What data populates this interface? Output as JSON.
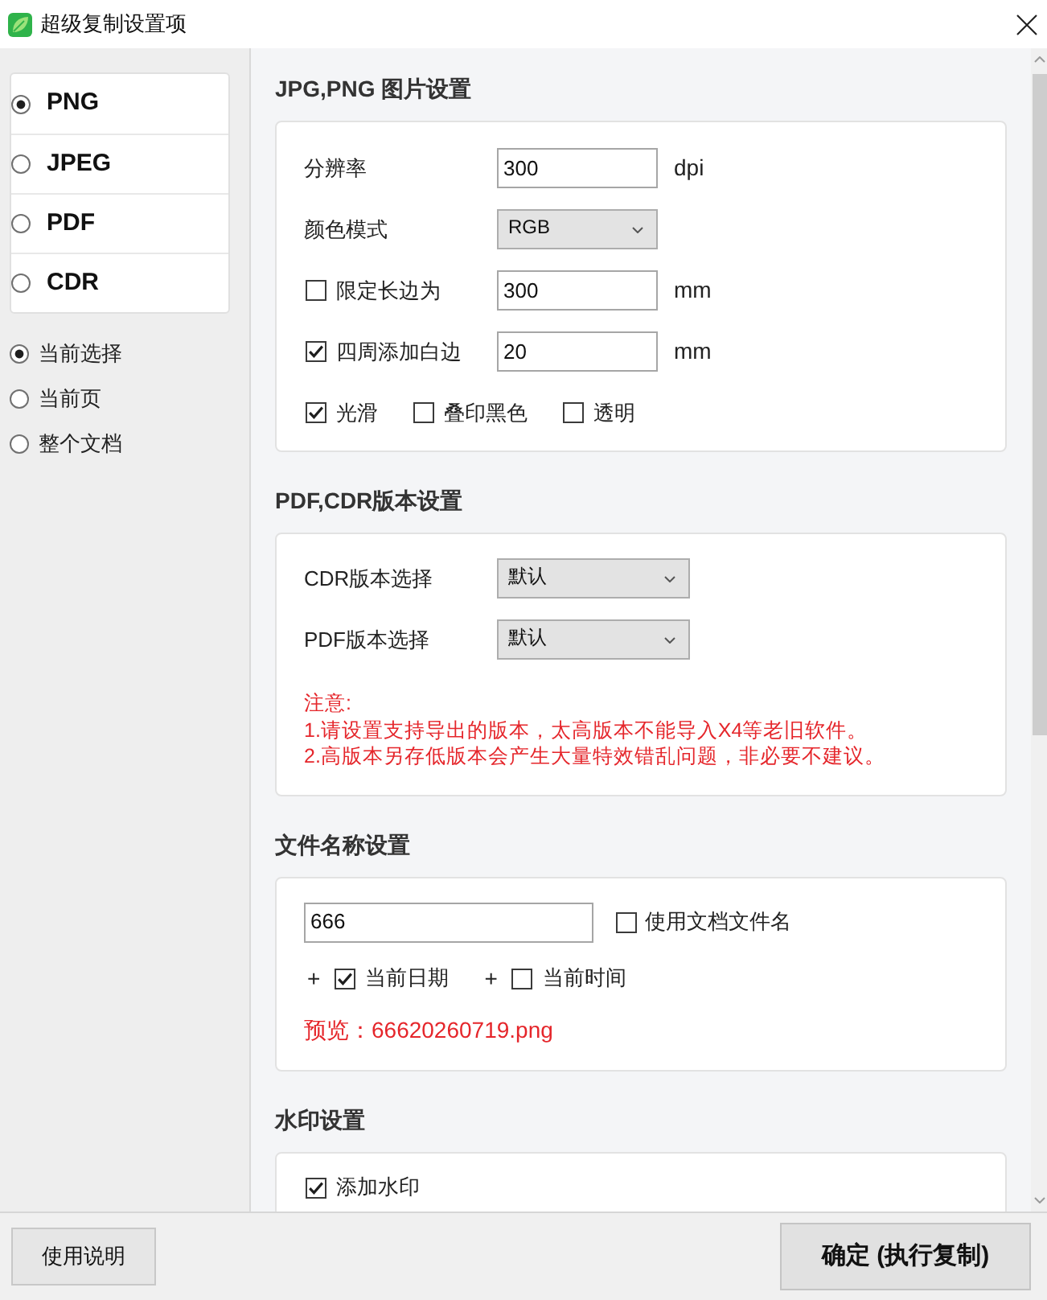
{
  "window": {
    "title": "超级复制设置项"
  },
  "formats": [
    {
      "label": "PNG",
      "selected": true
    },
    {
      "label": "JPEG",
      "selected": false
    },
    {
      "label": "PDF",
      "selected": false
    },
    {
      "label": "CDR",
      "selected": false
    }
  ],
  "scope": [
    {
      "label": "当前选择",
      "selected": true
    },
    {
      "label": "当前页",
      "selected": false
    },
    {
      "label": "整个文档",
      "selected": false
    }
  ],
  "sections": [
    {
      "title": "JPG,PNG 图片设置",
      "rows": [
        {
          "kind": "input",
          "label": "分辨率",
          "value": "300",
          "unit": "dpi"
        },
        {
          "kind": "select",
          "label": "颜色模式",
          "value": "RGB"
        },
        {
          "kind": "check_input",
          "label": "限定长边为",
          "checked": false,
          "value": "300",
          "unit": "mm"
        },
        {
          "kind": "check_input",
          "label": "四周添加白边",
          "checked": true,
          "value": "20",
          "unit": "mm"
        },
        {
          "kind": "checks",
          "items": [
            {
              "label": "光滑",
              "checked": true
            },
            {
              "label": "叠印黑色",
              "checked": false
            },
            {
              "label": "透明",
              "checked": false
            }
          ]
        }
      ]
    },
    {
      "title": "PDF,CDR版本设置",
      "rows": [
        {
          "kind": "select",
          "label": "CDR版本选择",
          "value": "默认"
        },
        {
          "kind": "select",
          "label": "PDF版本选择",
          "value": "默认"
        },
        {
          "kind": "note",
          "lines": [
            "注意:",
            "1.请设置支持导出的版本，太高版本不能导入X4等老旧软件。",
            "2.高版本另存低版本会产生大量特效错乱问题，非必要不建议。"
          ]
        }
      ]
    },
    {
      "title": "文件名称设置",
      "rows": [
        {
          "kind": "filename",
          "value": "666",
          "option": {
            "label": "使用文档文件名",
            "checked": false
          }
        },
        {
          "kind": "plus_checks",
          "items": [
            {
              "prefix": "+",
              "label": "当前日期",
              "checked": true
            },
            {
              "prefix": "+",
              "label": "当前时间",
              "checked": false
            }
          ]
        },
        {
          "kind": "preview",
          "text": "预览：66620260719.png"
        }
      ]
    },
    {
      "title": "水印设置",
      "rows": [
        {
          "kind": "checks",
          "items": [
            {
              "label": "添加水印",
              "checked": true
            }
          ]
        }
      ]
    }
  ],
  "footer": {
    "help_button": "使用说明",
    "confirm_button": "确定 (执行复制)"
  }
}
